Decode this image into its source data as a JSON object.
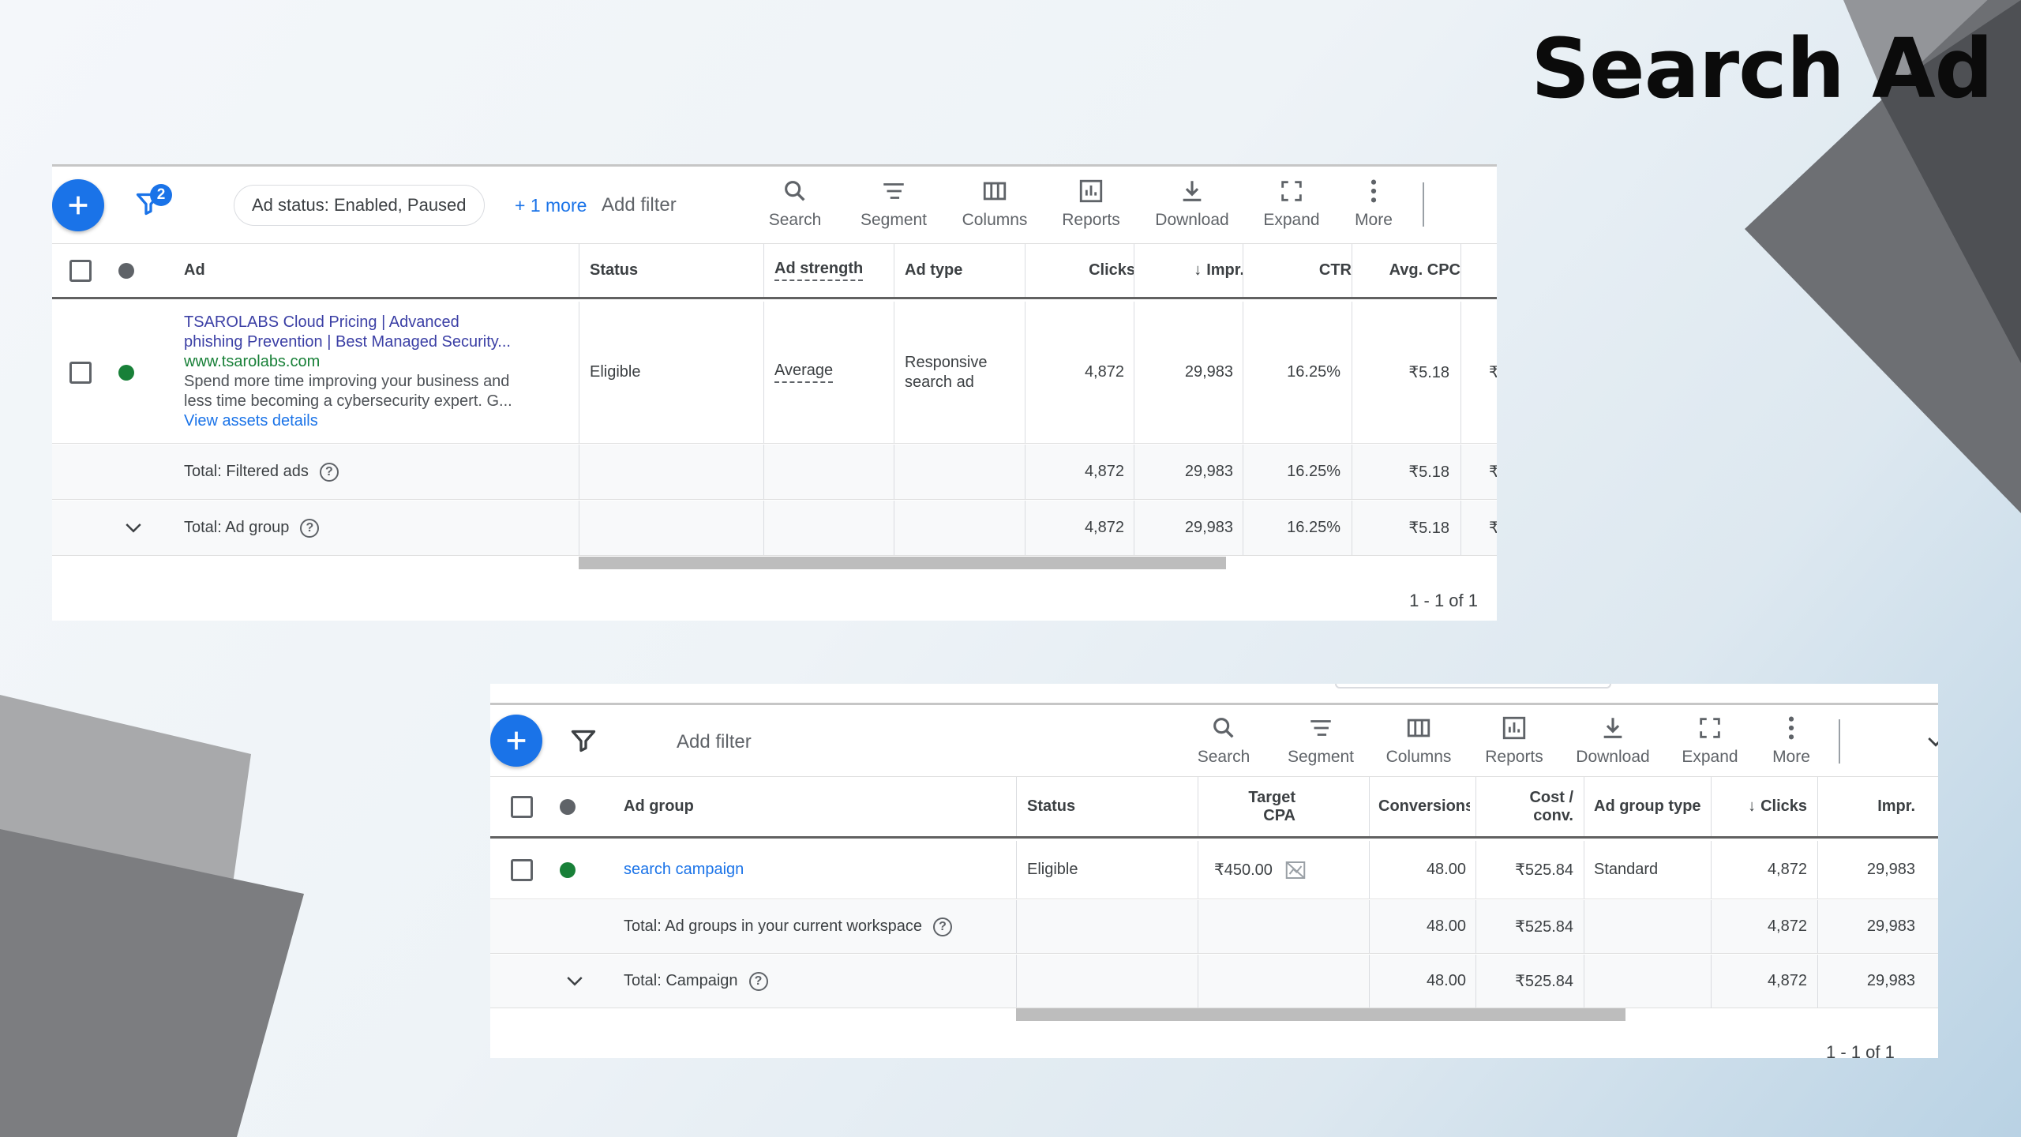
{
  "slide": {
    "title": "Search Ad"
  },
  "ads_table": {
    "filter_count": "2",
    "chip": "Ad status: Enabled, Paused",
    "more_filters": "+ 1 more",
    "add_filter": "Add filter",
    "toolbar": [
      "Search",
      "Segment",
      "Columns",
      "Reports",
      "Download",
      "Expand",
      "More"
    ],
    "headers": {
      "ad": "Ad",
      "status": "Status",
      "ad_strength": "Ad strength",
      "ad_type": "Ad type",
      "clicks": "Clicks",
      "impr": "Impr.",
      "ctr": "CTR",
      "avg_cpc": "Avg. CPC",
      "cost_prefix": "₹"
    },
    "row": {
      "headline1": "TSAROLABS Cloud Pricing | Advanced",
      "headline2": "phishing Prevention | Best Managed Security...",
      "url": "www.tsarolabs.com",
      "desc1": "Spend more time improving your business and",
      "desc2": "less time becoming a cybersecurity expert. G...",
      "assets_link": "View assets details",
      "status": "Eligible",
      "ad_strength": "Average",
      "ad_type1": "Responsive",
      "ad_type2": "search ad",
      "clicks": "4,872",
      "impr": "29,983",
      "ctr": "16.25%",
      "avg_cpc": "₹5.18",
      "cost": "₹"
    },
    "total_filtered": {
      "label": "Total: Filtered ads",
      "clicks": "4,872",
      "impr": "29,983",
      "ctr": "16.25%",
      "avg_cpc": "₹5.18",
      "cost": "₹"
    },
    "total_group": {
      "label": "Total: Ad group",
      "clicks": "4,872",
      "impr": "29,983",
      "ctr": "16.25%",
      "avg_cpc": "₹5.18",
      "cost": "₹"
    },
    "pager": "1 - 1 of 1"
  },
  "adgroups_table": {
    "add_filter": "Add filter",
    "toolbar": [
      "Search",
      "Segment",
      "Columns",
      "Reports",
      "Download",
      "Expand",
      "More"
    ],
    "headers": {
      "ad_group": "Ad group",
      "status": "Status",
      "target_cpa_1": "Target",
      "target_cpa_2": "CPA",
      "conversions": "Conversions",
      "cost_conv_1": "Cost /",
      "cost_conv_2": "conv.",
      "ad_group_type": "Ad group type",
      "clicks": "Clicks",
      "impr": "Impr."
    },
    "row": {
      "name": "search campaign",
      "status": "Eligible",
      "target_cpa": "₹450.00",
      "conversions": "48.00",
      "cost_conv": "₹525.84",
      "type": "Standard",
      "clicks": "4,872",
      "impr": "29,983"
    },
    "total_workspace": {
      "label": "Total: Ad groups in your current workspace",
      "conversions": "48.00",
      "cost_conv": "₹525.84",
      "clicks": "4,872",
      "impr": "29,983"
    },
    "total_campaign": {
      "label": "Total: Campaign",
      "conversions": "48.00",
      "cost_conv": "₹525.84",
      "clicks": "4,872",
      "impr": "29,983"
    },
    "pager": "1 - 1 of 1"
  }
}
